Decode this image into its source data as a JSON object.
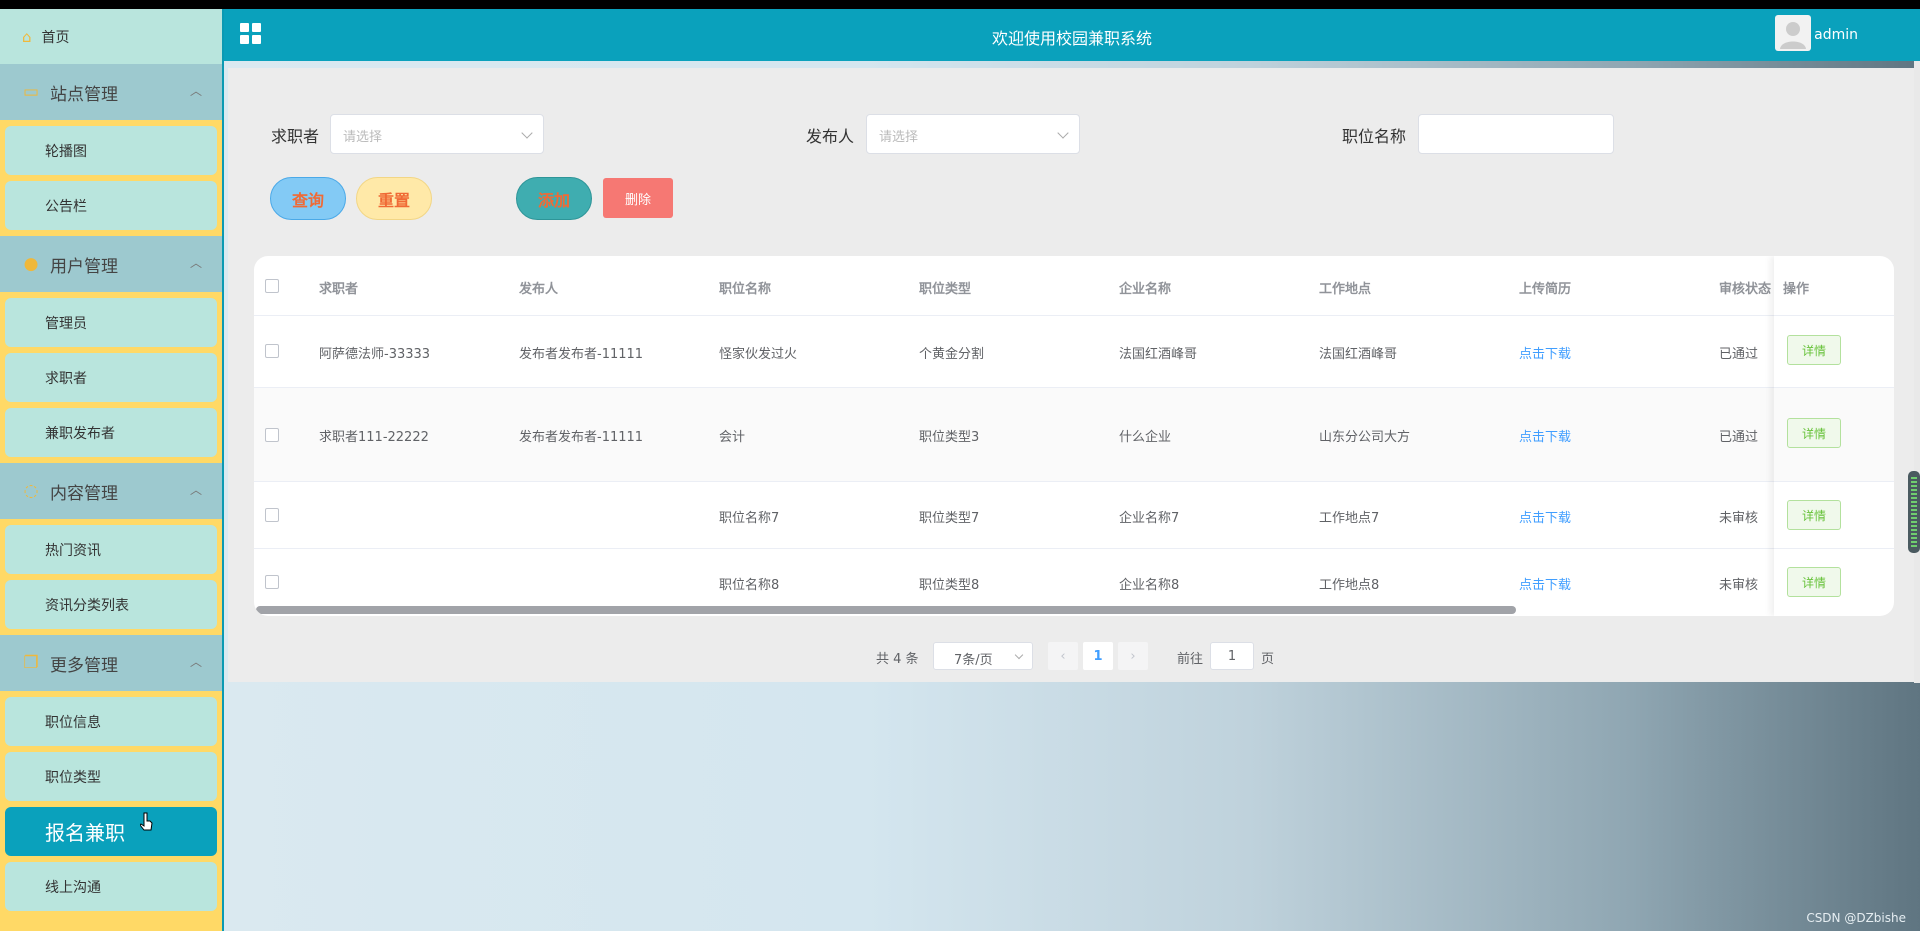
{
  "topbar": {
    "title": "欢迎使用校园兼职系统",
    "username": "admin"
  },
  "sidebar": {
    "home_label": "首页",
    "groups": [
      {
        "title": "站点管理",
        "icon": "monitor-icon",
        "items": [
          "轮播图",
          "公告栏"
        ]
      },
      {
        "title": "用户管理",
        "icon": "user-icon",
        "items": [
          "管理员",
          "求职者",
          "兼职发布者"
        ]
      },
      {
        "title": "内容管理",
        "icon": "chat-icon",
        "items": [
          "热门资讯",
          "资讯分类列表"
        ]
      },
      {
        "title": "更多管理",
        "icon": "copy-icon",
        "items": [
          "职位信息",
          "职位类型",
          "报名兼职",
          "线上沟通"
        ]
      }
    ],
    "active_item": "报名兼职"
  },
  "filters": {
    "seeker_label": "求职者",
    "seeker_placeholder": "请选择",
    "publisher_label": "发布人",
    "publisher_placeholder": "请选择",
    "position_label": "职位名称",
    "position_value": ""
  },
  "buttons": {
    "query": "查询",
    "reset": "重置",
    "add": "添加",
    "delete": "删除"
  },
  "table": {
    "headers": [
      "求职者",
      "发布人",
      "职位名称",
      "职位类型",
      "企业名称",
      "工作地点",
      "上传简历",
      "审核状态",
      "操作"
    ],
    "rows": [
      {
        "seeker": "阿萨德法师-33333",
        "publisher": "发布者发布者-11111",
        "position": "怪家伙发过火",
        "type": "个黄金分割",
        "company": "法国红酒峰哥",
        "location": "法国红酒峰哥",
        "resume": "点击下载",
        "status": "已通过",
        "action": "详情"
      },
      {
        "seeker": "求职者111-22222",
        "publisher": "发布者发布者-11111",
        "position": "会计",
        "type": "职位类型3",
        "company": "什么企业",
        "location": "山东分公司大方",
        "resume": "点击下载",
        "status": "已通过",
        "action": "详情"
      },
      {
        "seeker": "",
        "publisher": "",
        "position": "职位名称7",
        "type": "职位类型7",
        "company": "企业名称7",
        "location": "工作地点7",
        "resume": "点击下载",
        "status": "未审核",
        "action": "详情"
      },
      {
        "seeker": "",
        "publisher": "",
        "position": "职位名称8",
        "type": "职位类型8",
        "company": "企业名称8",
        "location": "工作地点8",
        "resume": "点击下载",
        "status": "未审核",
        "action": "详情"
      }
    ]
  },
  "pagination": {
    "total": "共 4 条",
    "page_size": "7条/页",
    "prev": "‹",
    "current": "1",
    "next": "›",
    "goto_label": "前往",
    "goto_value": "1",
    "page_suffix": "页"
  },
  "watermark": "CSDN @DZbishe",
  "colors": {
    "primary": "#0aa1bc",
    "sidebar_bg": "#ffd966",
    "submenu_bg": "#b9e5dd",
    "group_bg": "#9dc9cf",
    "delete_btn": "#f67873",
    "link": "#409eff"
  }
}
